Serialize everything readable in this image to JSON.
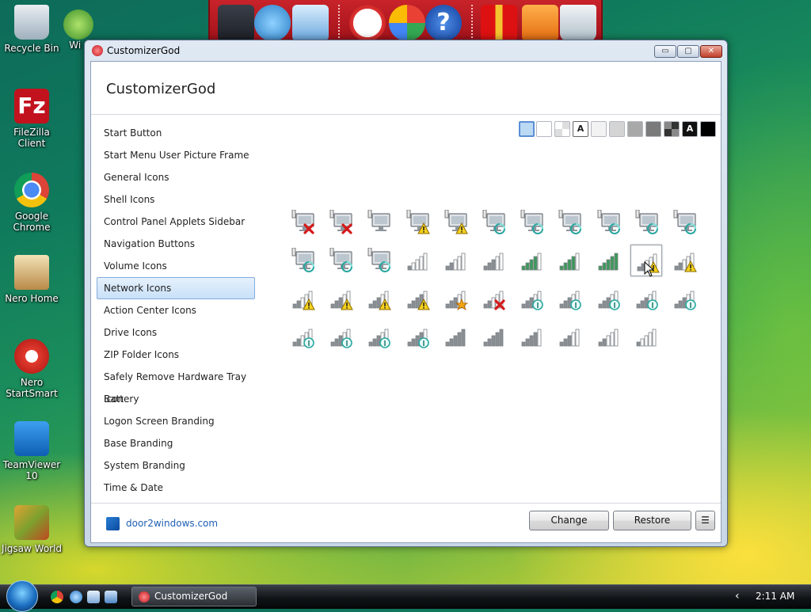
{
  "desktop": {
    "icons": [
      {
        "label": "Recycle Bin"
      },
      {
        "label": "Wi L"
      },
      {
        "label": "FileZilla Client"
      },
      {
        "label": "Google Chrome"
      },
      {
        "label": "Nero Home"
      },
      {
        "label": "Nero StartSmart"
      },
      {
        "label": "TeamViewer 10"
      },
      {
        "label": "Jigsaw World"
      }
    ]
  },
  "window": {
    "title": "CustomizerGod",
    "app_title": "CustomizerGod",
    "controls": {
      "minimize": "▭",
      "maximize": "▢",
      "close": "✕"
    }
  },
  "nav": {
    "items": [
      {
        "label": "Start Button"
      },
      {
        "label": "Start Menu User Picture Frame"
      },
      {
        "label": "General Icons"
      },
      {
        "label": "Shell Icons"
      },
      {
        "label": "Control Panel Applets Sidebar"
      },
      {
        "label": "Navigation Buttons"
      },
      {
        "label": "Volume Icons"
      },
      {
        "label": "Network Icons"
      },
      {
        "label": "Action Center Icons"
      },
      {
        "label": "Drive Icons"
      },
      {
        "label": "ZIP Folder Icons"
      },
      {
        "label": "Safely Remove Hardware Tray Icon"
      },
      {
        "label": "Battery"
      },
      {
        "label": "Logon Screen Branding"
      },
      {
        "label": "Base Branding"
      },
      {
        "label": "System Branding"
      },
      {
        "label": "Time & Date"
      }
    ],
    "selected": "Network Icons"
  },
  "swatches": {
    "colors": [
      "#bcd9f4",
      "#ffffff",
      "checker",
      "#ffffff",
      "#f2f2f2",
      "#d4d4d4",
      "#a8a8a8",
      "#7a7a7a",
      "checker-dark",
      "#111111",
      "#000000"
    ],
    "letters": {
      "a_light": "A",
      "a_dark": "A"
    }
  },
  "footer": {
    "link": "door2windows.com",
    "change_label": "Change",
    "restore_label": "Restore",
    "menu_label": "☰"
  },
  "taskbar": {
    "task_label": "CustomizerGod",
    "tray_arrow": "‹",
    "clock": "2:11 AM"
  }
}
